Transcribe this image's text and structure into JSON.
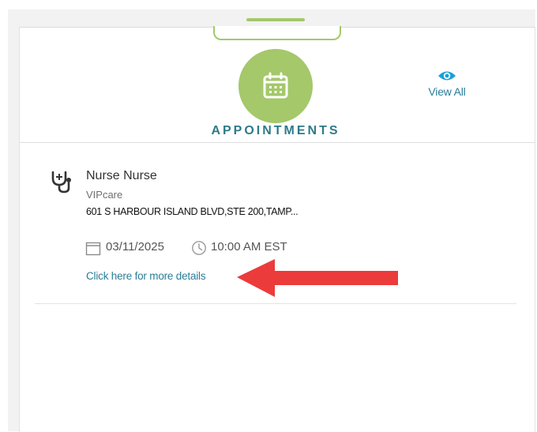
{
  "widget": {
    "title": "APPOINTMENTS",
    "view_all_label": "View All",
    "icons": {
      "main": "calendar-icon",
      "view_all": "eye-icon"
    },
    "colors": {
      "accent_green": "#a4c86a",
      "title_teal": "#2e7a8a",
      "link_blue": "#2a7d99",
      "annotation_red": "#ec3b3b"
    }
  },
  "appointment": {
    "name": "Nurse Nurse",
    "provider": "VIPcare",
    "address": "601 S HARBOUR ISLAND BLVD,STE 200,TAMP...",
    "date": "03/11/2025",
    "time": "10:00 AM EST",
    "details_link": "Click here for more details",
    "icons": {
      "type": "stethoscope-icon",
      "date": "calendar-icon",
      "time": "clock-icon"
    }
  }
}
